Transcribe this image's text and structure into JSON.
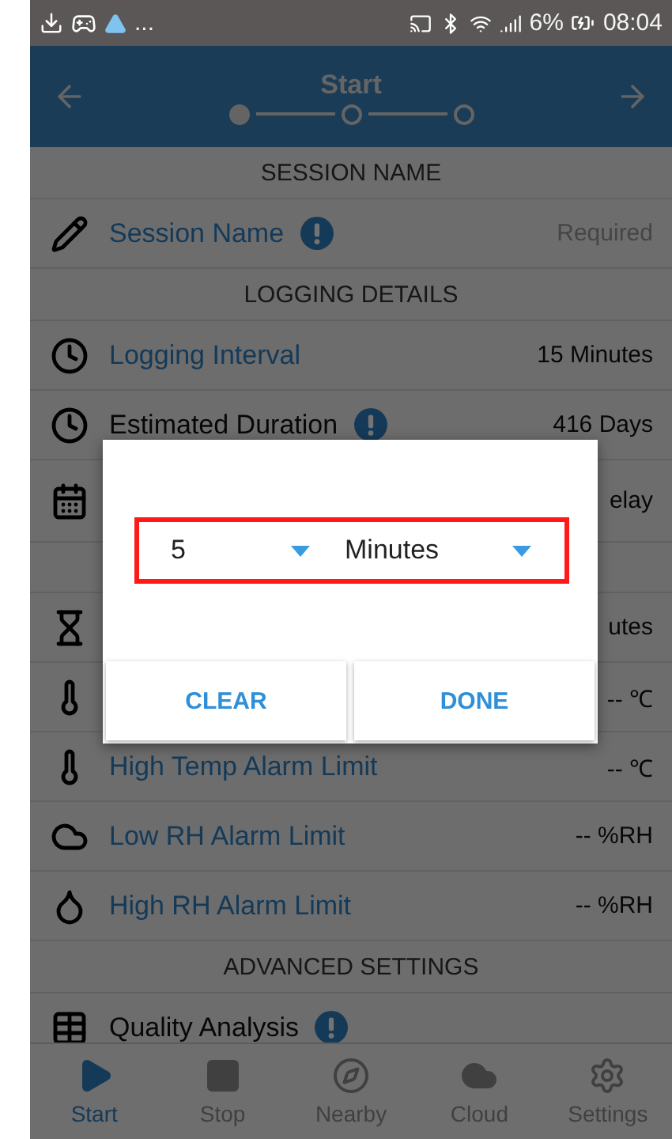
{
  "status_bar": {
    "more": "...",
    "battery": "6%",
    "time": "08:04"
  },
  "header": {
    "title": "Start",
    "steps": [
      {
        "selected": true
      },
      {
        "selected": false
      },
      {
        "selected": false
      }
    ]
  },
  "rows": [
    {
      "kind": "section",
      "label": "SESSION NAME"
    },
    {
      "kind": "item",
      "label": "Session Name",
      "editable": true,
      "info": true,
      "placeholder": "Required"
    },
    {
      "kind": "section",
      "label": "LOGGING DETAILS"
    },
    {
      "kind": "item",
      "label": "Logging Interval",
      "editable": true,
      "info": false,
      "value": "15 Minutes"
    },
    {
      "kind": "item",
      "label": "Estimated Duration",
      "editable": false,
      "info": true,
      "value": "416 Days"
    },
    {
      "kind": "tall",
      "value": "elay"
    },
    {
      "kind": "covered"
    },
    {
      "kind": "item",
      "value": "utes"
    },
    {
      "kind": "item",
      "value": "-- ℃"
    },
    {
      "kind": "item",
      "label": "High Temp Alarm Limit",
      "editable": true,
      "info": false,
      "value": "-- ℃"
    },
    {
      "kind": "item",
      "label": "Low RH Alarm Limit",
      "editable": true,
      "info": false,
      "value": "-- %RH"
    },
    {
      "kind": "item",
      "label": "High RH Alarm Limit",
      "editable": true,
      "info": false,
      "value": "-- %RH"
    },
    {
      "kind": "section",
      "label": "ADVANCED SETTINGS"
    },
    {
      "kind": "item",
      "label": "Quality Analysis",
      "editable": false,
      "info": true
    }
  ],
  "dialog": {
    "selects": [
      {
        "value": "5"
      },
      {
        "value": "Minutes"
      }
    ],
    "buttons": [
      "CLEAR",
      "DONE"
    ]
  },
  "nav": [
    {
      "label": "Start",
      "selected": true
    },
    {
      "label": "Stop",
      "selected": false
    },
    {
      "label": "Nearby",
      "selected": false
    },
    {
      "label": "Cloud",
      "selected": false
    },
    {
      "label": "Settings",
      "selected": false
    }
  ]
}
